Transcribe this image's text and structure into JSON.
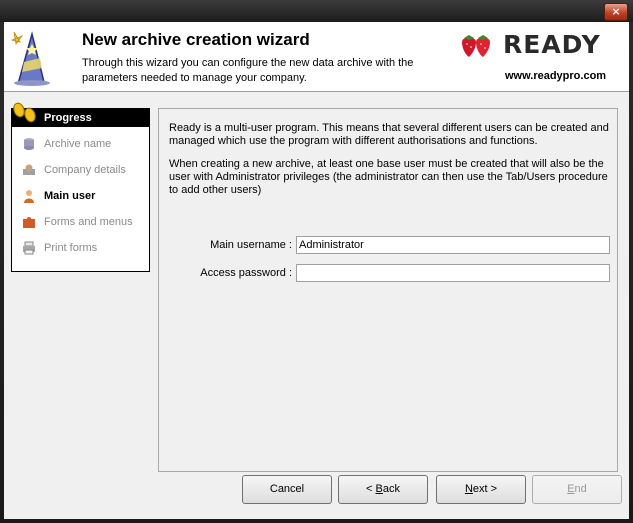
{
  "window": {
    "close_glyph": "×"
  },
  "header": {
    "title": "New archive creation wizard",
    "description": "Through this wizard you can configure the new data archive with the parameters needed to manage your company.",
    "brand": "READY",
    "website": "www.readypro.com",
    "icon": "wizard-hat-icon"
  },
  "progress": {
    "title": "Progress",
    "steps": [
      {
        "label": "Archive name",
        "icon": "database-icon",
        "active": false
      },
      {
        "label": "Company details",
        "icon": "company-icon",
        "active": false
      },
      {
        "label": "Main user",
        "icon": "user-icon",
        "active": true
      },
      {
        "label": "Forms and menus",
        "icon": "puzzle-icon",
        "active": false
      },
      {
        "label": "Print forms",
        "icon": "printer-icon",
        "active": false
      }
    ]
  },
  "main": {
    "para1": "Ready is a multi-user program. This means that several different users can be created and managed which use the program with different authorisations and functions.",
    "para2": "When creating a new archive, at least one base user must be created that will also be the user with Administrator privileges (the administrator can then use the Tab/Users procedure to add other users)",
    "username_label": "Main username :",
    "username_value": "Administrator",
    "password_label": "Access password :",
    "password_value": ""
  },
  "buttons": {
    "cancel": "Cancel",
    "back_prefix": "< ",
    "back_key": "B",
    "back_rest": "ack",
    "next_key": "N",
    "next_rest": "ext >",
    "end_key": "E",
    "end_rest": "nd"
  },
  "colors": {
    "accent": "#000000",
    "disabled_text": "#9a9a9a",
    "brand_red": "#c8102e"
  }
}
